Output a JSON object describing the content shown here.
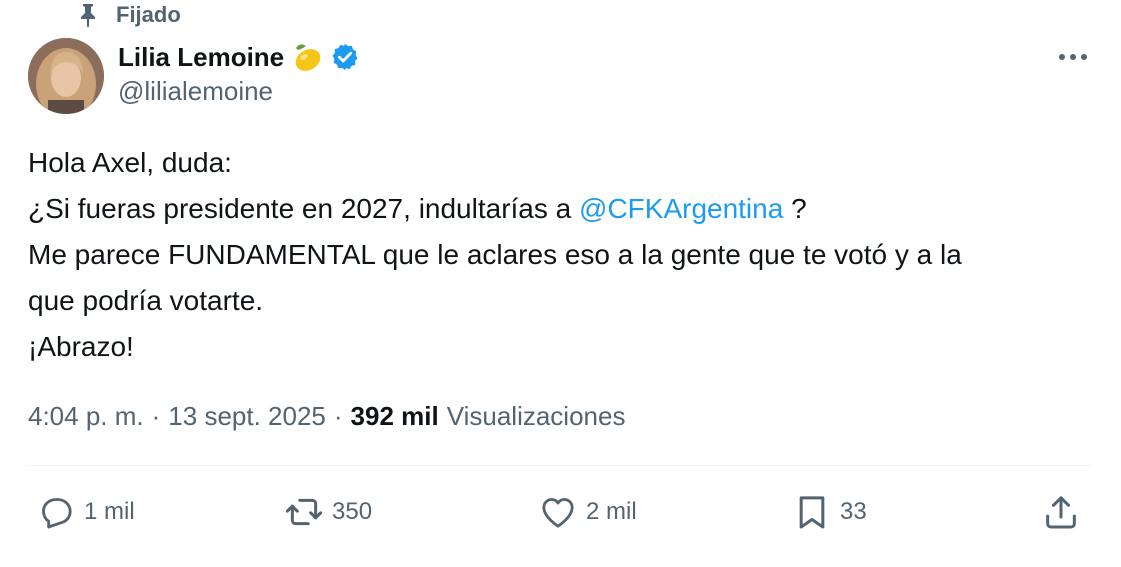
{
  "pinned": {
    "label": "Fijado",
    "icon": "pin-icon"
  },
  "author": {
    "display_name": "Lilia Lemoine",
    "emoji": "lemon-emoji-icon",
    "verified_icon": "verified-badge-icon",
    "handle": "@lilialemoine",
    "avatar": "avatar"
  },
  "more_icon": "more-options-icon",
  "tweet": {
    "line1": "Hola Axel, duda:",
    "line2_prefix": "¿Si fueras presidente en 2027, indultarías a ",
    "mention": "@CFKArgentina",
    "line2_suffix": " ?",
    "line3": "Me parece FUNDAMENTAL que le aclares eso a la gente que te votó y a la",
    "line4": "que podría votarte.",
    "line5": "¡Abrazo!"
  },
  "meta": {
    "time": "4:04 p. m.",
    "separator": "·",
    "date": "13 sept. 2025",
    "views_count": "392 mil",
    "views_label": "Visualizaciones"
  },
  "actions": {
    "reply": {
      "count": "1 mil",
      "icon": "reply-icon"
    },
    "retweet": {
      "count": "350",
      "icon": "retweet-icon"
    },
    "like": {
      "count": "2 mil",
      "icon": "heart-icon"
    },
    "bookmark": {
      "count": "33",
      "icon": "bookmark-icon"
    },
    "share": {
      "icon": "share-icon"
    }
  },
  "colors": {
    "text_primary": "#0f1419",
    "text_secondary": "#536471",
    "accent": "#1d9bf0",
    "divider": "#eff3f4"
  }
}
